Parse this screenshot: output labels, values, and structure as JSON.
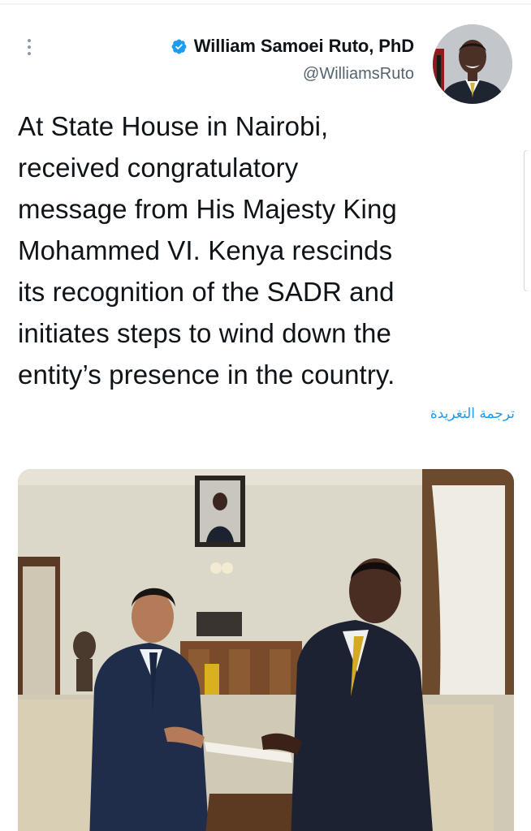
{
  "tweet": {
    "author": {
      "display_name": "William Samoei Ruto, PhD",
      "handle": "@WilliamsRuto",
      "verified": true,
      "avatar_icon": "profile-photo"
    },
    "text": "At State House in Nairobi,\nreceived congratulatory\nmessage from His Majesty King\nMohammed VI. Kenya rescinds\nits recognition of the SADR and\ninitiates steps to wind down the\nentity’s presence in the country.",
    "translate_label": "ترجمة التغريدة",
    "more_icon": "more-vertical-icon"
  },
  "colors": {
    "link": "#1d9bf0",
    "secondary_text": "#536471",
    "primary_text": "#0f1419",
    "verified_badge": "#1d9bf0"
  }
}
